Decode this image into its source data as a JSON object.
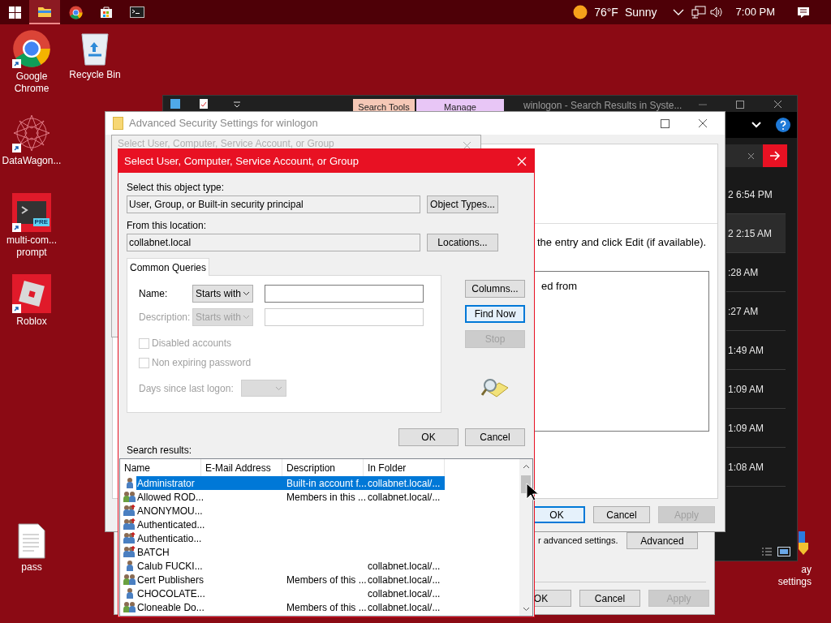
{
  "taskbar": {
    "apps": [
      {
        "kind": "explorer",
        "selected": true
      },
      {
        "kind": "chrome",
        "selected": false
      },
      {
        "kind": "store",
        "selected": false
      },
      {
        "kind": "terminal",
        "selected": false
      }
    ],
    "weather": {
      "temperature": "76°F",
      "condition": "Sunny"
    },
    "clock": "7:00 PM"
  },
  "desktop_icons": [
    {
      "kind": "chrome",
      "label": "Google Chrome"
    },
    {
      "kind": "recycle",
      "label": "Recycle Bin"
    },
    {
      "kind": "datawagon",
      "label": "DataWagon..."
    },
    {
      "kind": "terminal",
      "label": "multi-com... prompt",
      "badge": "PRE"
    },
    {
      "kind": "roblox",
      "label": "Roblox"
    },
    {
      "kind": "file",
      "label": "pass"
    },
    {
      "kind": "settings",
      "label": "ay settings"
    }
  ],
  "explorer_window": {
    "title": "winlogon - Search Results in Syste...",
    "ribbon_tabs": [
      "Search Tools",
      "Manage"
    ],
    "rows": [
      {
        "time": "2 6:54 PM",
        "selected": false
      },
      {
        "time": "2 2:15 AM",
        "selected": true
      },
      {
        "time": ":28 AM",
        "selected": false
      },
      {
        "time": ":27 AM",
        "selected": false
      },
      {
        "time": "1:49 AM",
        "selected": false
      },
      {
        "time": "1:09 AM",
        "selected": false
      },
      {
        "time": "1:09 AM",
        "selected": false
      },
      {
        "time": "1:08 AM",
        "selected": false
      }
    ]
  },
  "properties_window": {
    "text": "r advanced settings.",
    "advanced_button": {
      "label": "Advanced",
      "disabled": false,
      "focused": false
    },
    "buttons": [
      {
        "label": "OK",
        "disabled": false,
        "focused": false
      },
      {
        "label": "Cancel",
        "disabled": false,
        "focused": false
      },
      {
        "label": "Apply",
        "disabled": true,
        "focused": false
      }
    ]
  },
  "security_window": {
    "title": "Advanced Security Settings for winlogon",
    "instruction": "the entry and click Edit (if available).",
    "list_text": "ed from",
    "buttons": [
      {
        "label": "OK",
        "disabled": false,
        "focused": true
      },
      {
        "label": "Cancel",
        "disabled": false,
        "focused": false
      },
      {
        "label": "Apply",
        "disabled": true,
        "focused": false
      }
    ]
  },
  "background_dialog": {
    "title": "Select User, Computer, Service Account, or Group"
  },
  "select_dialog": {
    "title": "Select User, Computer, Service Account, or Group",
    "object_type": {
      "label": "Select this object type:",
      "value": "User, Group, or Built-in security principal",
      "button": {
        "label": "Object Types...",
        "disabled": false,
        "focused": false
      }
    },
    "location": {
      "label": "From this location:",
      "value": "collabnet.local",
      "button": {
        "label": "Locations...",
        "disabled": false,
        "focused": false
      }
    },
    "tab": {
      "label": "Common Queries",
      "selected": true
    },
    "queries": [
      {
        "label": "Name:",
        "mode": "Starts with",
        "disabled": false
      },
      {
        "label": "Description:",
        "mode": "Starts with",
        "disabled": true
      }
    ],
    "checkboxes": [
      {
        "label": "Disabled accounts",
        "checked": false,
        "disabled": true
      },
      {
        "label": "Non expiring password",
        "checked": false,
        "disabled": true
      }
    ],
    "days": {
      "label": "Days since last logon:",
      "disabled": true
    },
    "side_buttons": [
      {
        "label": "Columns...",
        "disabled": false,
        "focused": false
      },
      {
        "label": "Find Now",
        "disabled": false,
        "focused": true
      },
      {
        "label": "Stop",
        "disabled": true,
        "focused": false
      }
    ],
    "buttons": [
      {
        "label": "OK",
        "disabled": false,
        "focused": false
      },
      {
        "label": "Cancel",
        "disabled": false,
        "focused": false
      }
    ],
    "results_label": "Search results:",
    "results": {
      "columns": [
        "Name",
        "E-Mail Address",
        "Description",
        "In Folder"
      ],
      "rows": [
        {
          "kind": "user",
          "name": "Administrator",
          "description": "Built-in account f...",
          "folder": "collabnet.local/...",
          "selected": true
        },
        {
          "kind": "group",
          "name": "Allowed ROD...",
          "description": "Members in this ...",
          "folder": "collabnet.local/...",
          "selected": false
        },
        {
          "kind": "special",
          "name": "ANONYMOU...",
          "selected": false
        },
        {
          "kind": "special",
          "name": "Authenticated...",
          "selected": false
        },
        {
          "kind": "special",
          "name": "Authenticatio...",
          "selected": false
        },
        {
          "kind": "special",
          "name": "BATCH",
          "selected": false
        },
        {
          "kind": "user",
          "name": "Calub FUCKI...",
          "folder": "collabnet.local/...",
          "selected": false
        },
        {
          "kind": "group",
          "name": "Cert Publishers",
          "description": "Members of this ...",
          "folder": "collabnet.local/...",
          "selected": false
        },
        {
          "kind": "user",
          "name": "CHOCOLATE...",
          "folder": "collabnet.local/...",
          "selected": false
        },
        {
          "kind": "group",
          "name": "Cloneable Do...",
          "description": "Members of this ...",
          "folder": "collabnet.local/...",
          "selected": false
        }
      ]
    }
  }
}
